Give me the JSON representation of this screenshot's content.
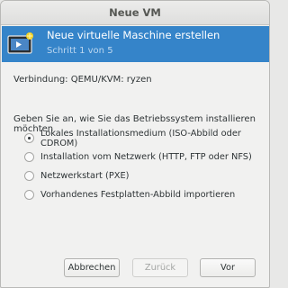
{
  "window": {
    "title": "Neue VM"
  },
  "header": {
    "title": "Neue virtuelle Maschine erstellen",
    "step": "Schritt 1 von 5",
    "icon": "new-vm-icon",
    "background_color": "#3584c9"
  },
  "connection": {
    "text": "Verbindung:  QEMU/KVM: ryzen"
  },
  "install": {
    "question": "Geben Sie an, wie Sie das Betriebssystem installieren möchten",
    "options": [
      {
        "label": "Lokales Installationsmedium (ISO-Abbild oder CDROM)",
        "selected": true
      },
      {
        "label": "Installation vom Netzwerk (HTTP, FTP oder NFS)",
        "selected": false
      },
      {
        "label": "Netzwerkstart (PXE)",
        "selected": false
      },
      {
        "label": "Vorhandenes Festplatten-Abbild importieren",
        "selected": false
      }
    ]
  },
  "buttons": {
    "cancel": "Abbrechen",
    "back": "Zurück",
    "next": "Vor",
    "back_disabled": true
  }
}
